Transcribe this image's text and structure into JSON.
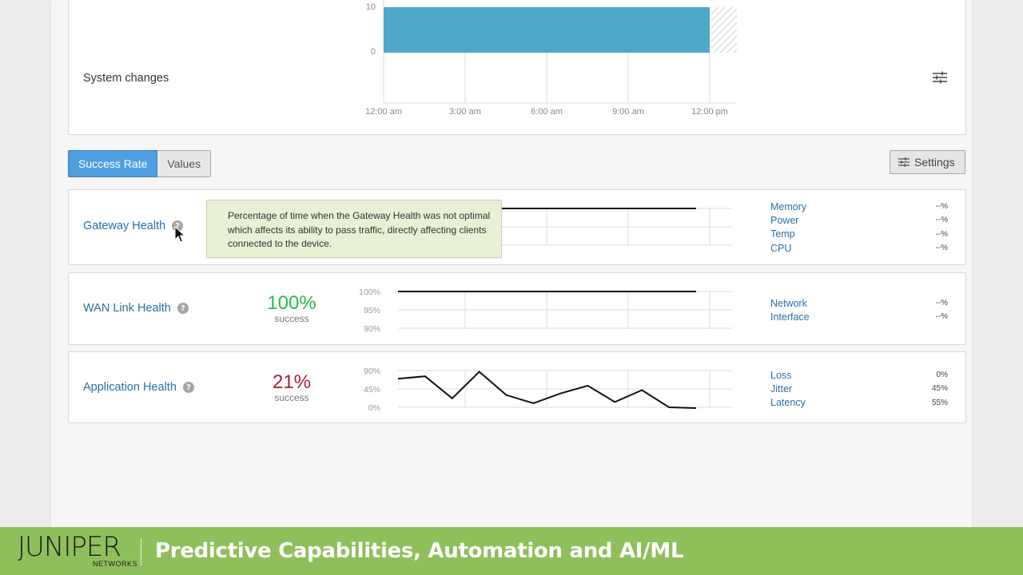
{
  "system_changes": {
    "title": "System changes",
    "y_tick_top": "10",
    "y_tick_zero": "0",
    "x_ticks": [
      "12:00 am",
      "3:00 am",
      "6:00 am",
      "9:00 am",
      "12:00 pm"
    ],
    "settings_icon": "sliders-icon"
  },
  "tabs": [
    {
      "label": "Success Rate",
      "active": true
    },
    {
      "label": "Values",
      "active": false
    }
  ],
  "settings_button": {
    "label": "Settings",
    "icon": "sliders-icon"
  },
  "gateway_health": {
    "title": "Gateway Health",
    "tooltip": "Percentage of time when the Gateway Health was not optimal which affects its ability to pass traffic, directly affecting clients connected to the device.",
    "metrics": [
      {
        "name": "Memory",
        "value": "--%"
      },
      {
        "name": "Power",
        "value": "--%"
      },
      {
        "name": "Temp",
        "value": "--%"
      },
      {
        "name": "CPU",
        "value": "--%"
      }
    ]
  },
  "wan_link_health": {
    "title": "WAN Link Health",
    "percent": "100%",
    "status": "success",
    "y_ticks": [
      "100%",
      "95%",
      "90%"
    ],
    "metrics": [
      {
        "name": "Network",
        "value": "--%"
      },
      {
        "name": "Interface",
        "value": "--%"
      }
    ]
  },
  "application_health": {
    "title": "Application Health",
    "percent": "21%",
    "status": "success",
    "y_ticks": [
      "90%",
      "45%",
      "0%"
    ],
    "metrics": [
      {
        "name": "Loss",
        "value": "0%"
      },
      {
        "name": "Jitter",
        "value": "45%"
      },
      {
        "name": "Latency",
        "value": "55%"
      }
    ]
  },
  "chart_data": [
    {
      "type": "line",
      "title": "Gateway Health",
      "x": [
        0,
        1,
        2,
        3,
        4,
        5,
        6,
        7,
        8,
        9,
        10,
        11
      ],
      "values": [
        100,
        100,
        100,
        100,
        100,
        100,
        100,
        100,
        100,
        100,
        100,
        100
      ]
    },
    {
      "type": "line",
      "title": "WAN Link Health",
      "x": [
        0,
        1,
        2,
        3,
        4,
        5,
        6,
        7,
        8,
        9,
        10,
        11
      ],
      "values": [
        100,
        100,
        100,
        100,
        100,
        100,
        100,
        100,
        100,
        100,
        100,
        100
      ],
      "ylim": [
        90,
        100
      ]
    },
    {
      "type": "line",
      "title": "Application Health",
      "x": [
        0,
        1,
        2,
        3,
        4,
        5,
        6,
        7,
        8,
        9,
        10,
        11
      ],
      "values": [
        70,
        76,
        22,
        87,
        30,
        10,
        34,
        53,
        13,
        42,
        0,
        -2
      ],
      "ylim": [
        0,
        90
      ]
    }
  ],
  "colors": {
    "bar": "#4ea8c9",
    "accent": "#4f9fe0",
    "link": "#2a6fa8",
    "success_green": "#2cb84a",
    "fail_red": "#a8202f",
    "footer": "#8fbf5b"
  },
  "footer": {
    "logo": "JUNIPER",
    "logo_sub": "NETWORKS",
    "title": "Predictive Capabilities, Automation and AI/ML"
  }
}
